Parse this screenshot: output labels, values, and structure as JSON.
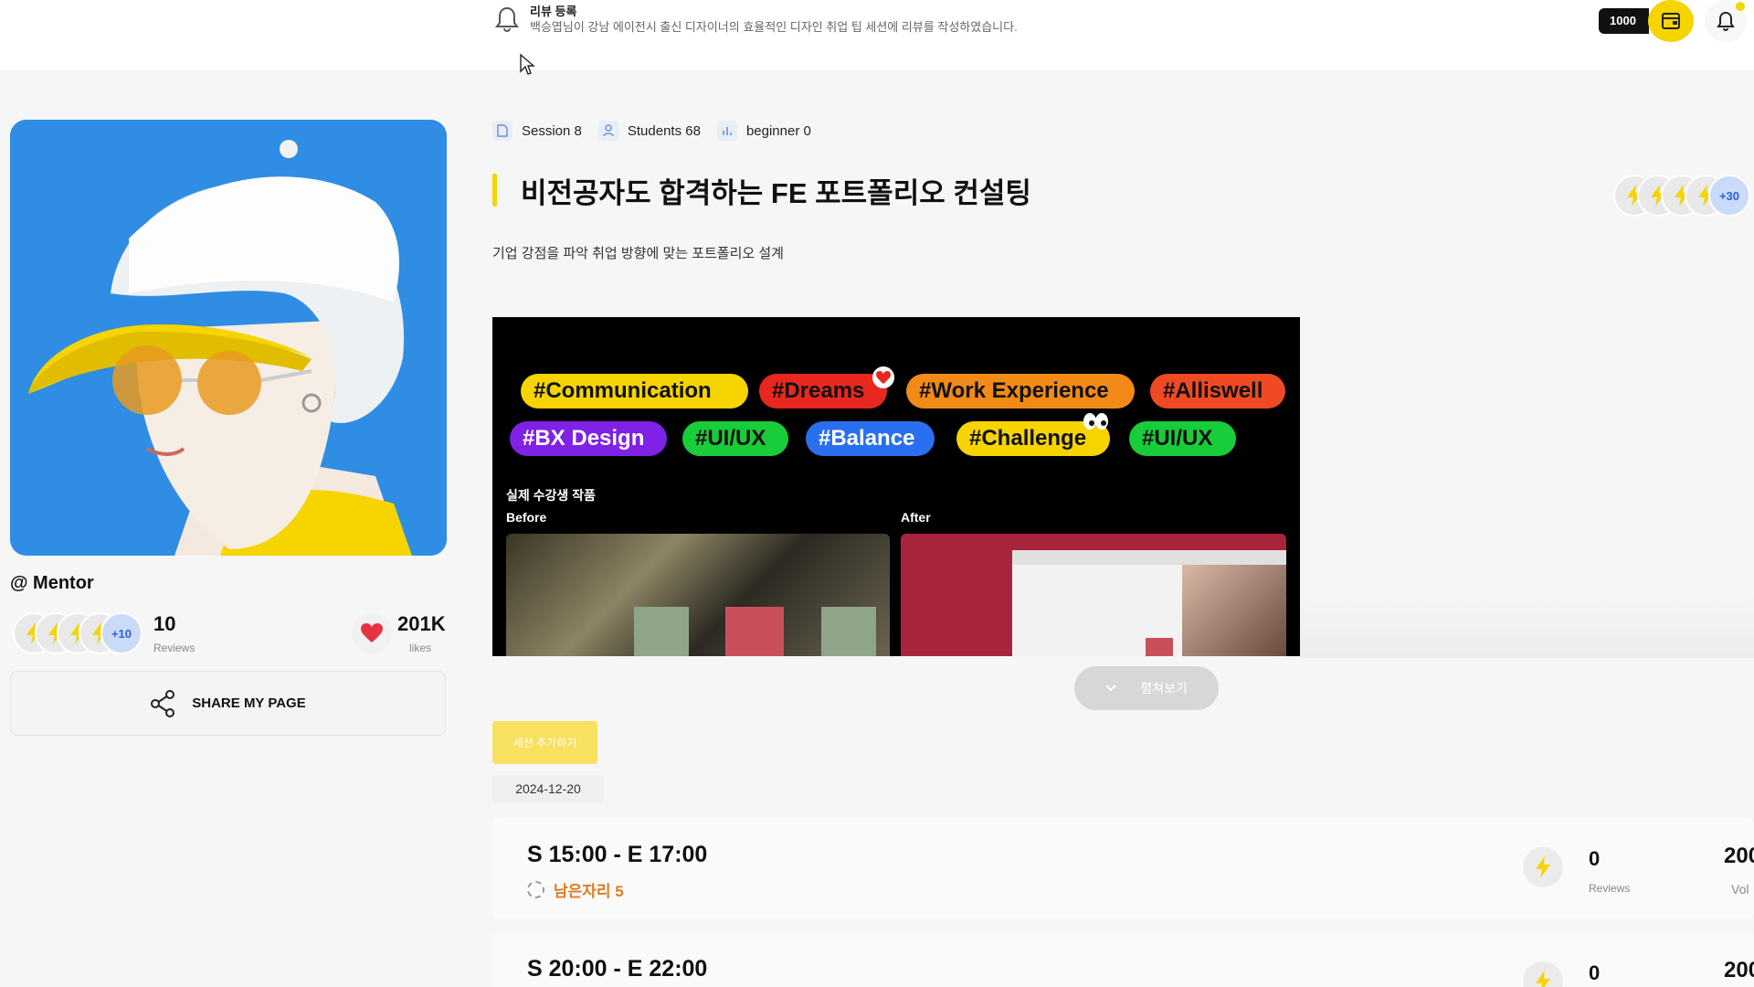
{
  "header": {
    "notification_title": "리뷰 등록",
    "notification_text": "백승엽님이 강남 에이전시 출신 디자이너의 효율적인 디자인 취업 팁 세션에 리뷰를 작성하였습니다.",
    "points": "1000",
    "icons": [
      "bell-icon",
      "wallet-icon",
      "notification-settings-icon",
      "cursor-icon"
    ]
  },
  "profile": {
    "handle": "@ Mentor",
    "reviewers_more": "+10",
    "reviews_count": "10",
    "reviews_label": "Reviews",
    "likes_count": "201K",
    "likes_label": "likes",
    "share_label": "SHARE MY PAGE"
  },
  "session": {
    "meta": [
      {
        "icon": "document-icon",
        "text": "Session 8"
      },
      {
        "icon": "user-icon",
        "text": "Students 68"
      },
      {
        "icon": "chart-icon",
        "text": "beginner 0"
      }
    ],
    "title": "비전공자도 합격하는 FE 포트폴리오 컨설팅",
    "subtitle": "기업 강점을 파악 취업 방향에 맞는 포트폴리오 설계",
    "participants_more": "+30",
    "expand_label": "펼쳐보기",
    "add_label": "세션 추가하기",
    "date": "2024-12-20"
  },
  "banner": {
    "tags": [
      "#Communication",
      "#Dreams",
      "#Work Experience",
      "#Alliswell",
      "#BX Design",
      "#UI/UX",
      "#Balance",
      "#Challenge",
      "#UI/UX"
    ],
    "colors": {
      "yellow": "#f5d400",
      "red": "#e8281e",
      "orange": "#f28a17",
      "redorange": "#ef4a23",
      "purple": "#7f22e6",
      "green": "#19cc3a",
      "blue": "#2a6ff0"
    },
    "caption": "실제 수강생 작품",
    "before_label": "Before",
    "after_label": "After"
  },
  "slots": [
    {
      "time": "S 15:00 - E 17:00",
      "seats": "남은자리 5",
      "reviews": "0",
      "reviews_label": "Reviews",
      "right_value": "200",
      "right_label": "Vol"
    },
    {
      "time": "S 20:00 - E 22:00",
      "reviews": "0",
      "right_value": "200"
    }
  ],
  "accent_color": "#f5d400"
}
